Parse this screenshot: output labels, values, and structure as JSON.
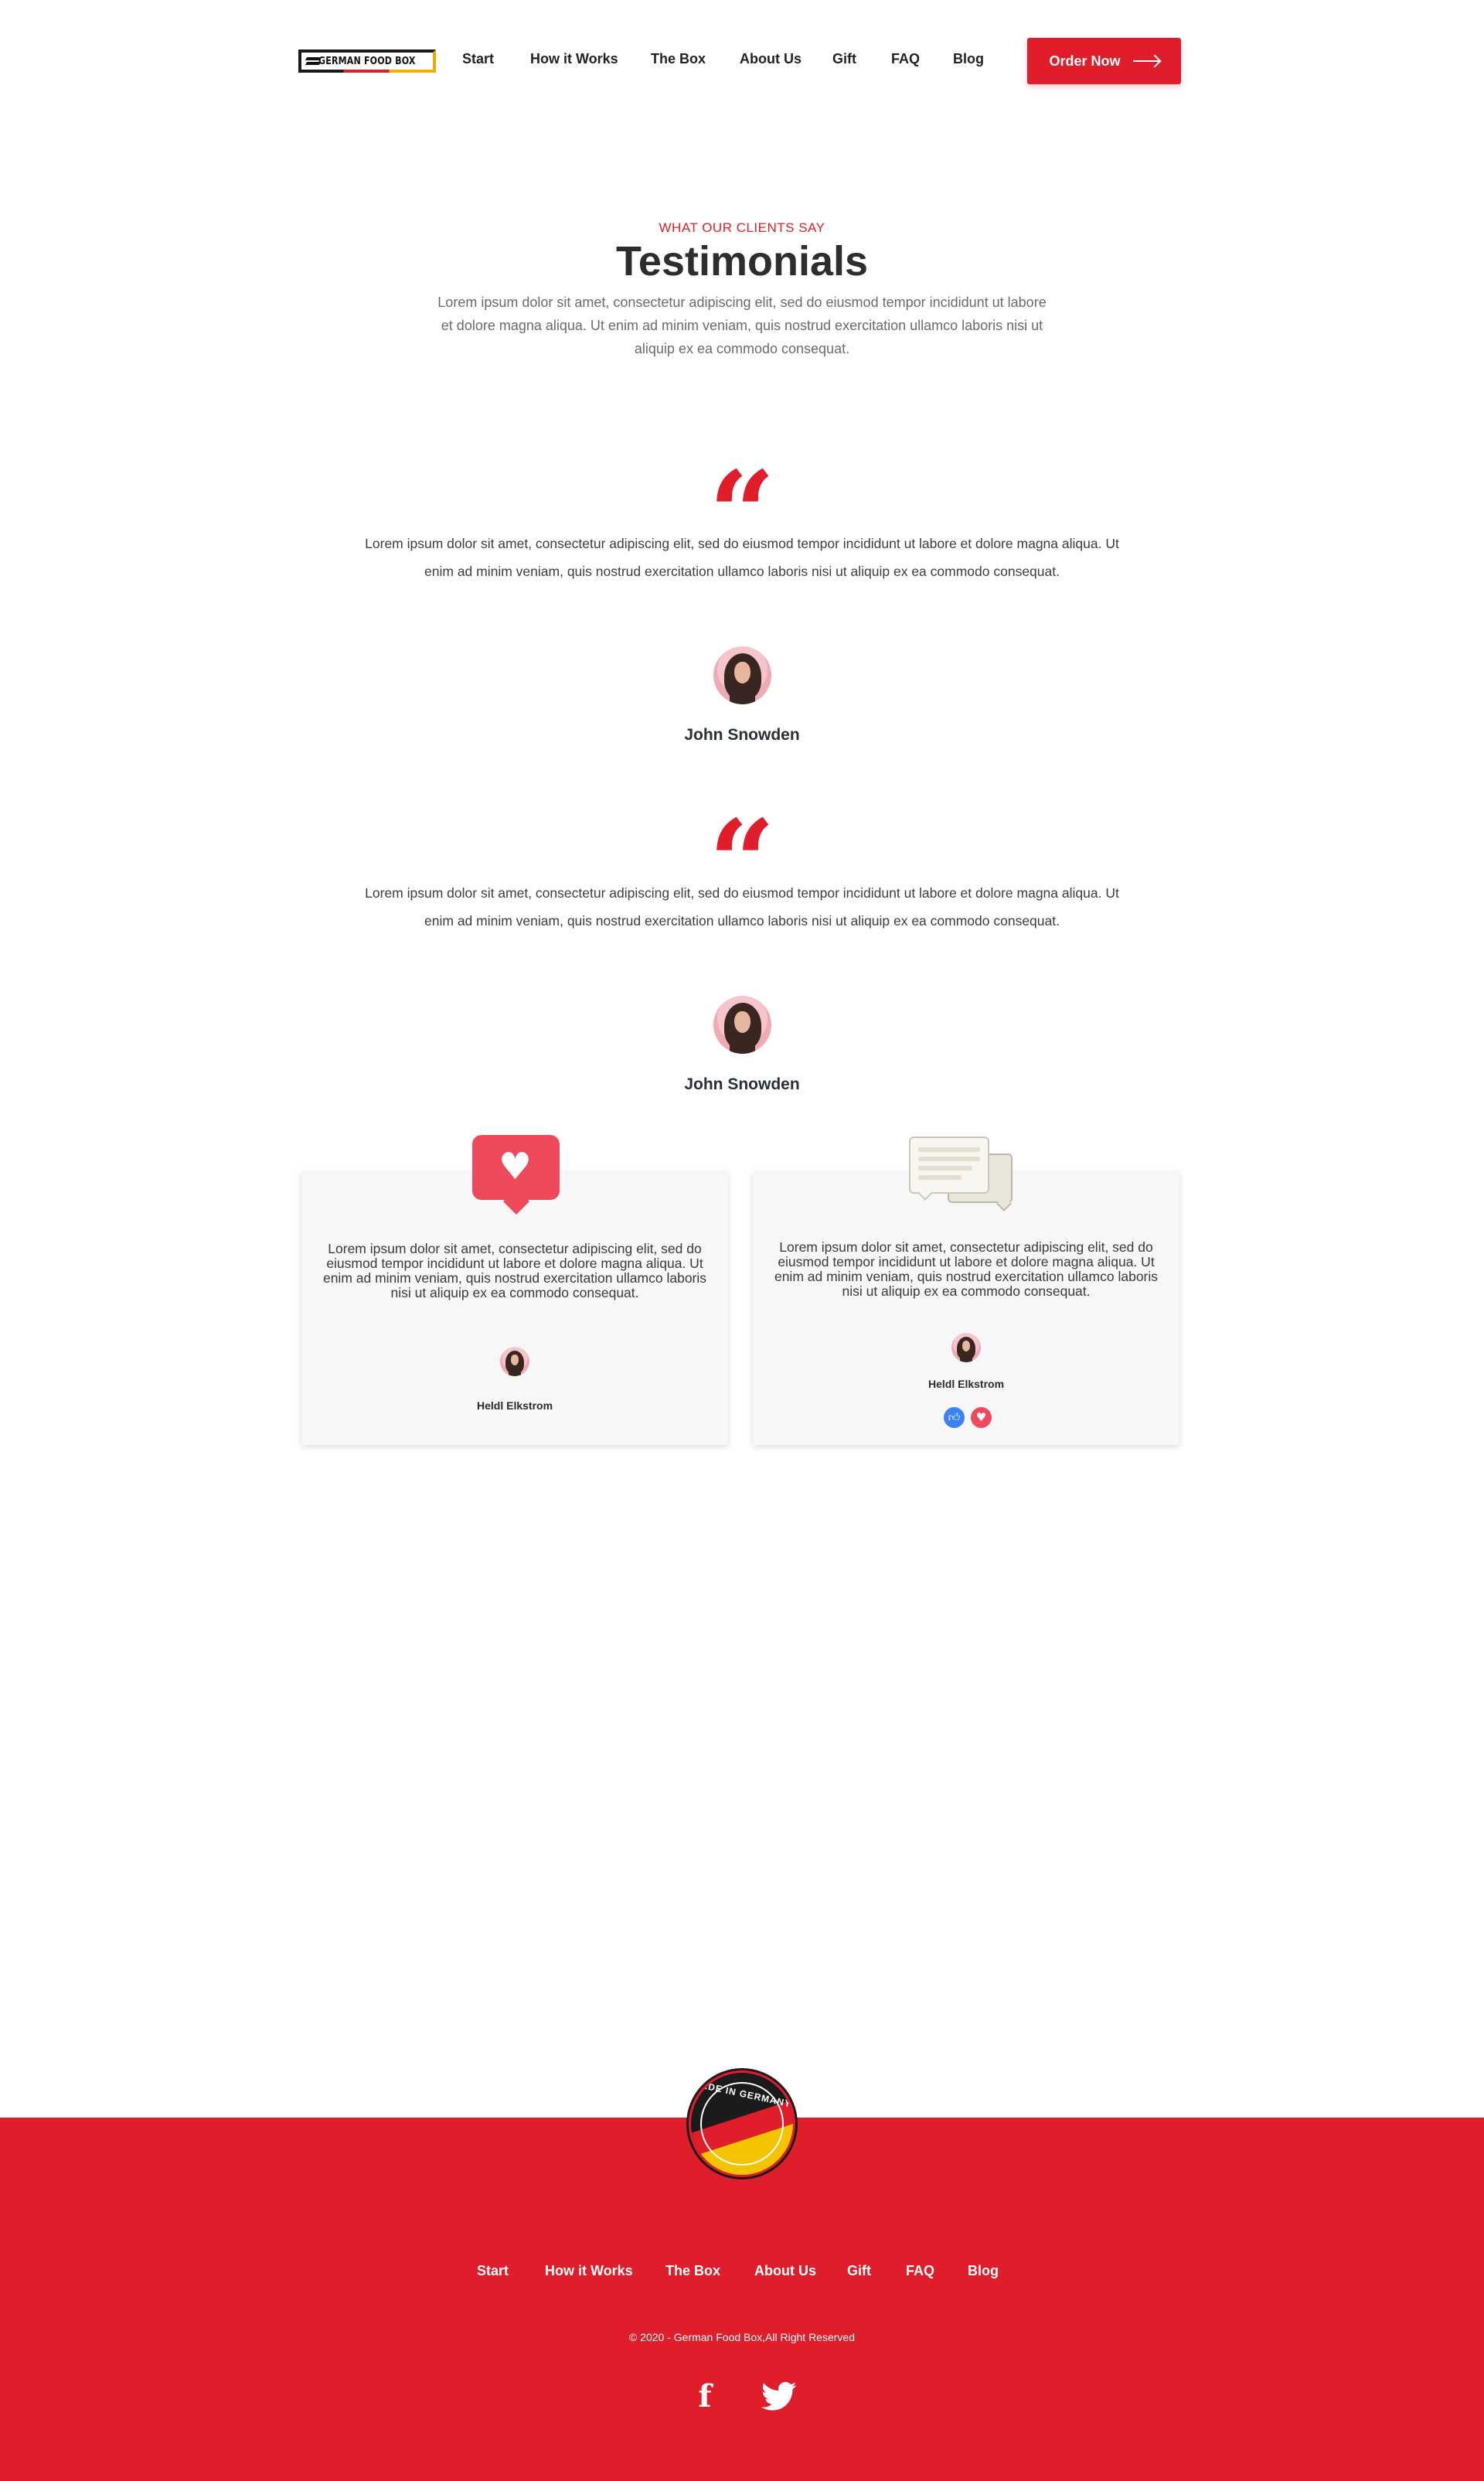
{
  "header": {
    "logo_text": "GERMAN FOOD BOX",
    "nav": [
      "Start",
      "How it Works",
      "The Box",
      "About Us",
      "Gift",
      "FAQ",
      "Blog"
    ],
    "order_button": "Order Now"
  },
  "testimonials": {
    "eyebrow": "WHAT OUR CLIENTS SAY",
    "title": "Testimonials",
    "intro": "Lorem ipsum dolor sit amet, consectetur adipiscing elit, sed do eiusmod tempor incididunt ut labore et dolore magna aliqua. Ut enim ad minim veniam, quis nostrud exercitation ullamco laboris nisi ut aliquip ex ea commodo consequat.",
    "quote_mark": "“",
    "items": [
      {
        "text": "Lorem ipsum dolor sit amet, consectetur adipiscing elit, sed do eiusmod tempor incididunt ut labore et dolore magna aliqua. Ut enim ad minim veniam, quis nostrud exercitation ullamco laboris nisi ut aliquip ex ea commodo consequat.",
        "name": "John Snowden"
      },
      {
        "text": "Lorem ipsum dolor sit amet, consectetur adipiscing elit, sed do eiusmod tempor incididunt ut labore et dolore magna aliqua. Ut enim ad minim veniam, quis nostrud exercitation ullamco laboris nisi ut aliquip ex ea commodo consequat.",
        "name": "John Snowden"
      }
    ],
    "cards": [
      {
        "icon": "heart-bubble-icon",
        "text": "Lorem ipsum dolor sit amet, consectetur adipiscing elit, sed do eiusmod tempor incididunt ut labore et dolore magna aliqua. Ut enim ad minim veniam, quis nostrud exercitation ullamco laboris nisi ut aliquip ex ea commodo consequat.",
        "name": "Heldl Elkstrom"
      },
      {
        "icon": "chat-bubbles-icon",
        "text": "Lorem ipsum dolor sit amet, consectetur adipiscing elit, sed do eiusmod tempor incididunt ut labore et dolore magna aliqua. Ut enim ad minim veniam, quis nostrud exercitation ullamco laboris nisi ut aliquip ex ea commodo consequat.",
        "name": "Heldl Elkstrom",
        "reactions": [
          "like-icon",
          "love-icon"
        ]
      }
    ]
  },
  "footer": {
    "badge_text": "MADE IN GERMANY",
    "nav": [
      "Start",
      "How it Works",
      "The Box",
      "About Us",
      "Gift",
      "FAQ",
      "Blog"
    ],
    "copyright": "© 2020 - German Food Box,All Right Reserved",
    "social": [
      "facebook-icon",
      "twitter-icon"
    ]
  },
  "colors": {
    "accent": "#e01e2b",
    "text_dark": "#2d2d2d",
    "card_bg": "#f7f7f7",
    "like_blue": "#3b82f6",
    "love_red": "#ef4a5b",
    "flag_gold": "#f5c400"
  }
}
